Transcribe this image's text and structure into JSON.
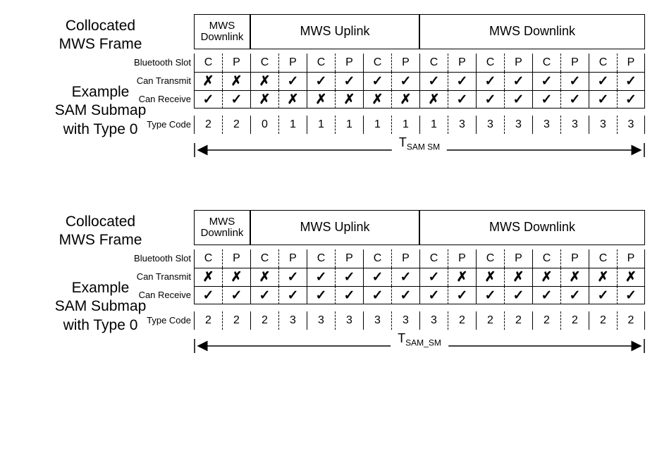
{
  "labels": {
    "collocated": "Collocated MWS Frame",
    "example": "Example SAM Submap with Type 0",
    "bluetooth_slot": "Bluetooth Slot",
    "can_transmit": "Can Transmit",
    "can_receive": "Can Receive",
    "type_code": "Type Code",
    "tsam_prefix": "T",
    "tsam_sub_1": "SAM SM",
    "tsam_sub_2": "SAM_SM"
  },
  "mws_headers": {
    "downlink_small": "MWS Downlink",
    "uplink": "MWS Uplink",
    "downlink": "MWS Downlink"
  },
  "slots": [
    "C",
    "P",
    "C",
    "P",
    "C",
    "P",
    "C",
    "P",
    "C",
    "P",
    "C",
    "P",
    "C",
    "P",
    "C",
    "P"
  ],
  "chart_data": [
    {
      "mws_spans": [
        {
          "label": "MWS Downlink",
          "slots": 2,
          "small": true
        },
        {
          "label": "MWS Uplink",
          "slots": 6,
          "small": false
        },
        {
          "label": "MWS Downlink",
          "slots": 8,
          "small": false
        }
      ],
      "can_transmit": [
        "x",
        "x",
        "x",
        "v",
        "v",
        "v",
        "v",
        "v",
        "v",
        "v",
        "v",
        "v",
        "v",
        "v",
        "v",
        "v"
      ],
      "can_receive": [
        "v",
        "v",
        "x",
        "x",
        "x",
        "x",
        "x",
        "x",
        "x",
        "v",
        "v",
        "v",
        "v",
        "v",
        "v",
        "v"
      ],
      "type_code": [
        "2",
        "2",
        "0",
        "1",
        "1",
        "1",
        "1",
        "1",
        "1",
        "3",
        "3",
        "3",
        "3",
        "3",
        "3",
        "3"
      ],
      "tsam_sub": "SAM SM"
    },
    {
      "mws_spans": [
        {
          "label": "MWS Downlink",
          "slots": 2,
          "small": true
        },
        {
          "label": "MWS Uplink",
          "slots": 6,
          "small": false
        },
        {
          "label": "MWS Downlink",
          "slots": 8,
          "small": false
        }
      ],
      "can_transmit": [
        "x",
        "x",
        "x",
        "v",
        "v",
        "v",
        "v",
        "v",
        "v",
        "x",
        "x",
        "x",
        "x",
        "x",
        "x",
        "x"
      ],
      "can_receive": [
        "v",
        "v",
        "v",
        "v",
        "v",
        "v",
        "v",
        "v",
        "v",
        "v",
        "v",
        "v",
        "v",
        "v",
        "v",
        "v"
      ],
      "type_code": [
        "2",
        "2",
        "2",
        "3",
        "3",
        "3",
        "3",
        "3",
        "3",
        "2",
        "2",
        "2",
        "2",
        "2",
        "2",
        "2"
      ],
      "tsam_sub": "SAM_SM"
    }
  ]
}
